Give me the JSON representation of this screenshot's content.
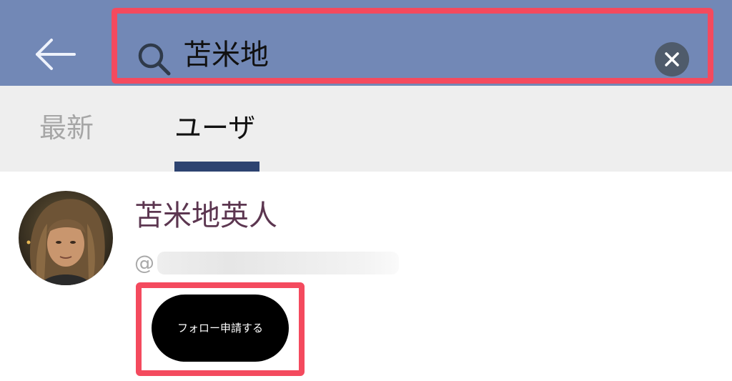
{
  "header": {
    "background_color": "#7288b6",
    "back_icon": "arrow-left-icon",
    "search": {
      "icon": "search-icon",
      "value": "苫米地",
      "placeholder": "",
      "clear_icon": "clear-circle-icon",
      "highlight_color": "#f44a5e"
    }
  },
  "tabs": {
    "items": [
      {
        "label": "最新",
        "selected": false
      },
      {
        "label": "ユーザ",
        "selected": true
      }
    ],
    "indicator_color": "#2d4370"
  },
  "results": [
    {
      "avatar": "avatar-photo",
      "name": "苫米地英人",
      "name_color": "#5c3650",
      "handle_prefix": "@",
      "follow_button": {
        "label": "フォロー申請する",
        "highlight_color": "#f44a5e"
      }
    }
  ]
}
